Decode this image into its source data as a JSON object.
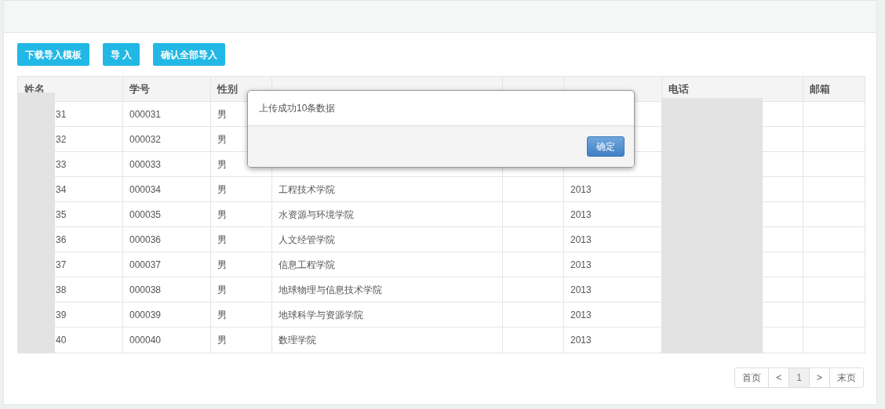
{
  "toolbar": [
    {
      "label": "下载导入模板"
    },
    {
      "label": "导 入"
    },
    {
      "label": "确认全部导入"
    }
  ],
  "table": {
    "columns": [
      "姓名",
      "学号",
      "性别",
      "电话",
      "邮箱"
    ],
    "rows": [
      {
        "name": "31",
        "id": "000031",
        "gender": "男"
      },
      {
        "name": "32",
        "id": "000032",
        "gender": "男"
      },
      {
        "name": "33",
        "id": "000033",
        "gender": "男"
      },
      {
        "name": "34",
        "id": "000034",
        "gender": "男",
        "college": "工程技术学院",
        "year": "2013"
      },
      {
        "name": "35",
        "id": "000035",
        "gender": "男",
        "college": "水资源与环境学院",
        "year": "2013"
      },
      {
        "name": "36",
        "id": "000036",
        "gender": "男",
        "college": "人文经管学院",
        "year": "2013"
      },
      {
        "name": "37",
        "id": "000037",
        "gender": "男",
        "college": "信息工程学院",
        "year": "2013"
      },
      {
        "name": "38",
        "id": "000038",
        "gender": "男",
        "college": "地球物理与信息技术学院",
        "year": "2013"
      },
      {
        "name": "39",
        "id": "000039",
        "gender": "男",
        "college": "地球科学与资源学院",
        "year": "2013"
      },
      {
        "name": "40",
        "id": "000040",
        "gender": "男",
        "college": "数理学院",
        "year": "2013"
      }
    ]
  },
  "pagination": [
    {
      "label": "首页",
      "selected": false
    },
    {
      "label": "<",
      "selected": false
    },
    {
      "label": "1",
      "selected": true
    },
    {
      "label": ">",
      "selected": false
    },
    {
      "label": "末页",
      "selected": false
    }
  ],
  "dialog": {
    "message": "上传成功10条数据",
    "button": "确定"
  }
}
